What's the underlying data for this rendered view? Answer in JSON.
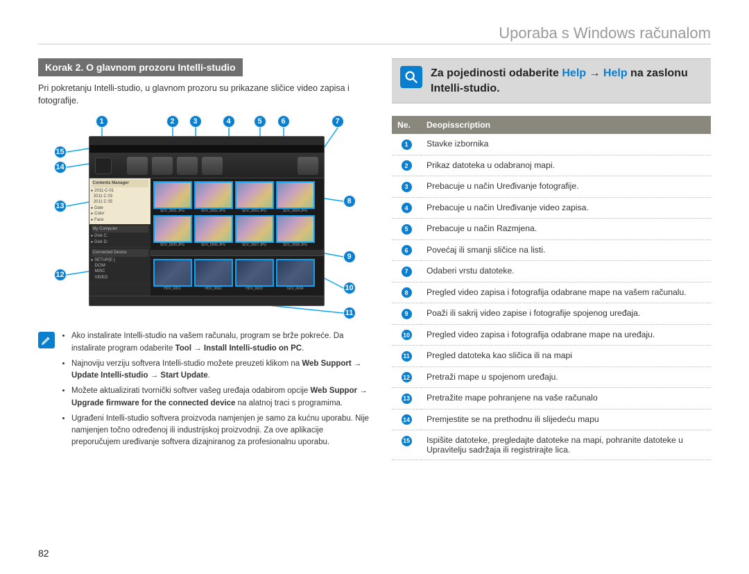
{
  "header_title": "Uporaba s Windows računalom",
  "step_bar": "Korak 2. O glavnom prozoru Intelli-studio",
  "intro_text": "Pri pokretanju Intelli-studio, u glavnom prozoru su prikazane sličice video zapisa i fotografije.",
  "arrow": "→",
  "notes": {
    "items": [
      {
        "pre": "Ako instalirate Intelli-studio na vašem računalu, program se brže pokreće. Da instalirate program odaberite ",
        "bold": "Tool → Install Intelli-studio on PC",
        "post": "."
      },
      {
        "pre": "Najnoviju verziju softvera Intelli-studio možete preuzeti klikom na ",
        "bold": "Web Support → Update Intelli-studio → Start Update",
        "post": "."
      },
      {
        "pre": "Možete aktualizirati tvornički softver vašeg uređaja odabirom opcije ",
        "bold": "Web Suppor → Upgrade firmware for the connected device",
        "post": " na alatnoj traci s programima."
      },
      {
        "pre": "Ugrađeni Intelli-studio softvera proizvoda namjenjen je samo za kućnu uporabu. Nije namjenjen točno određenoj ili industrijskoj proizvodnji. Za ove aplikacije preporučujem uređivanje softvera dizajniranog za profesionalnu uporabu.",
        "bold": "",
        "post": ""
      }
    ]
  },
  "help_callout": {
    "pre": "Za pojedinosti odaberite ",
    "link1": "Help",
    "mid": " → ",
    "link2": "Help",
    "post": " na zaslonu Intelli-studio."
  },
  "table": {
    "head_num": "Ne.",
    "head_desc": "Deopisscription",
    "rows": [
      {
        "n": "1",
        "d": "Stavke izbornika"
      },
      {
        "n": "2",
        "d": "Prikaz datoteka u odabranoj mapi."
      },
      {
        "n": "3",
        "d": "Prebacuje u način Uređivanje fotografije."
      },
      {
        "n": "4",
        "d": "Prebacuje u način Uređivanje video zapisa."
      },
      {
        "n": "5",
        "d": "Prebacuje u način Razmjena."
      },
      {
        "n": "6",
        "d": "Povećaj ili smanji sličice na listi."
      },
      {
        "n": "7",
        "d": "Odaberi vrstu datoteke."
      },
      {
        "n": "8",
        "d": "Pregled video zapisa i fotografija odabrane mape na vašem računalu."
      },
      {
        "n": "9",
        "d": "Poaži ili sakrij video zapise i fotografije spojenog uređaja."
      },
      {
        "n": "10",
        "d": "Pregled video zapisa i fotografija odabrane mape na uređaju."
      },
      {
        "n": "11",
        "d": "Pregled datoteka kao sličica ili na mapi"
      },
      {
        "n": "12",
        "d": "Pretraži mape u spojenom uređaju."
      },
      {
        "n": "13",
        "d": "Pretražite mape pohranjene na vaše računalo"
      },
      {
        "n": "14",
        "d": "Premjestite se na prethodnu ili slijedeću mapu"
      },
      {
        "n": "15",
        "d": "Ispišite datoteke, pregledajte datoteke na mapi, pohranite datoteke u Upravitelju sadržaja ili registrirajte lica."
      }
    ]
  },
  "diagram_labels": {
    "top": [
      "1",
      "2",
      "3",
      "4",
      "5",
      "6",
      "7"
    ],
    "right": [
      "8",
      "9",
      "10",
      "11"
    ],
    "left": [
      "15",
      "14",
      "13",
      "12"
    ]
  },
  "page_number": "82"
}
